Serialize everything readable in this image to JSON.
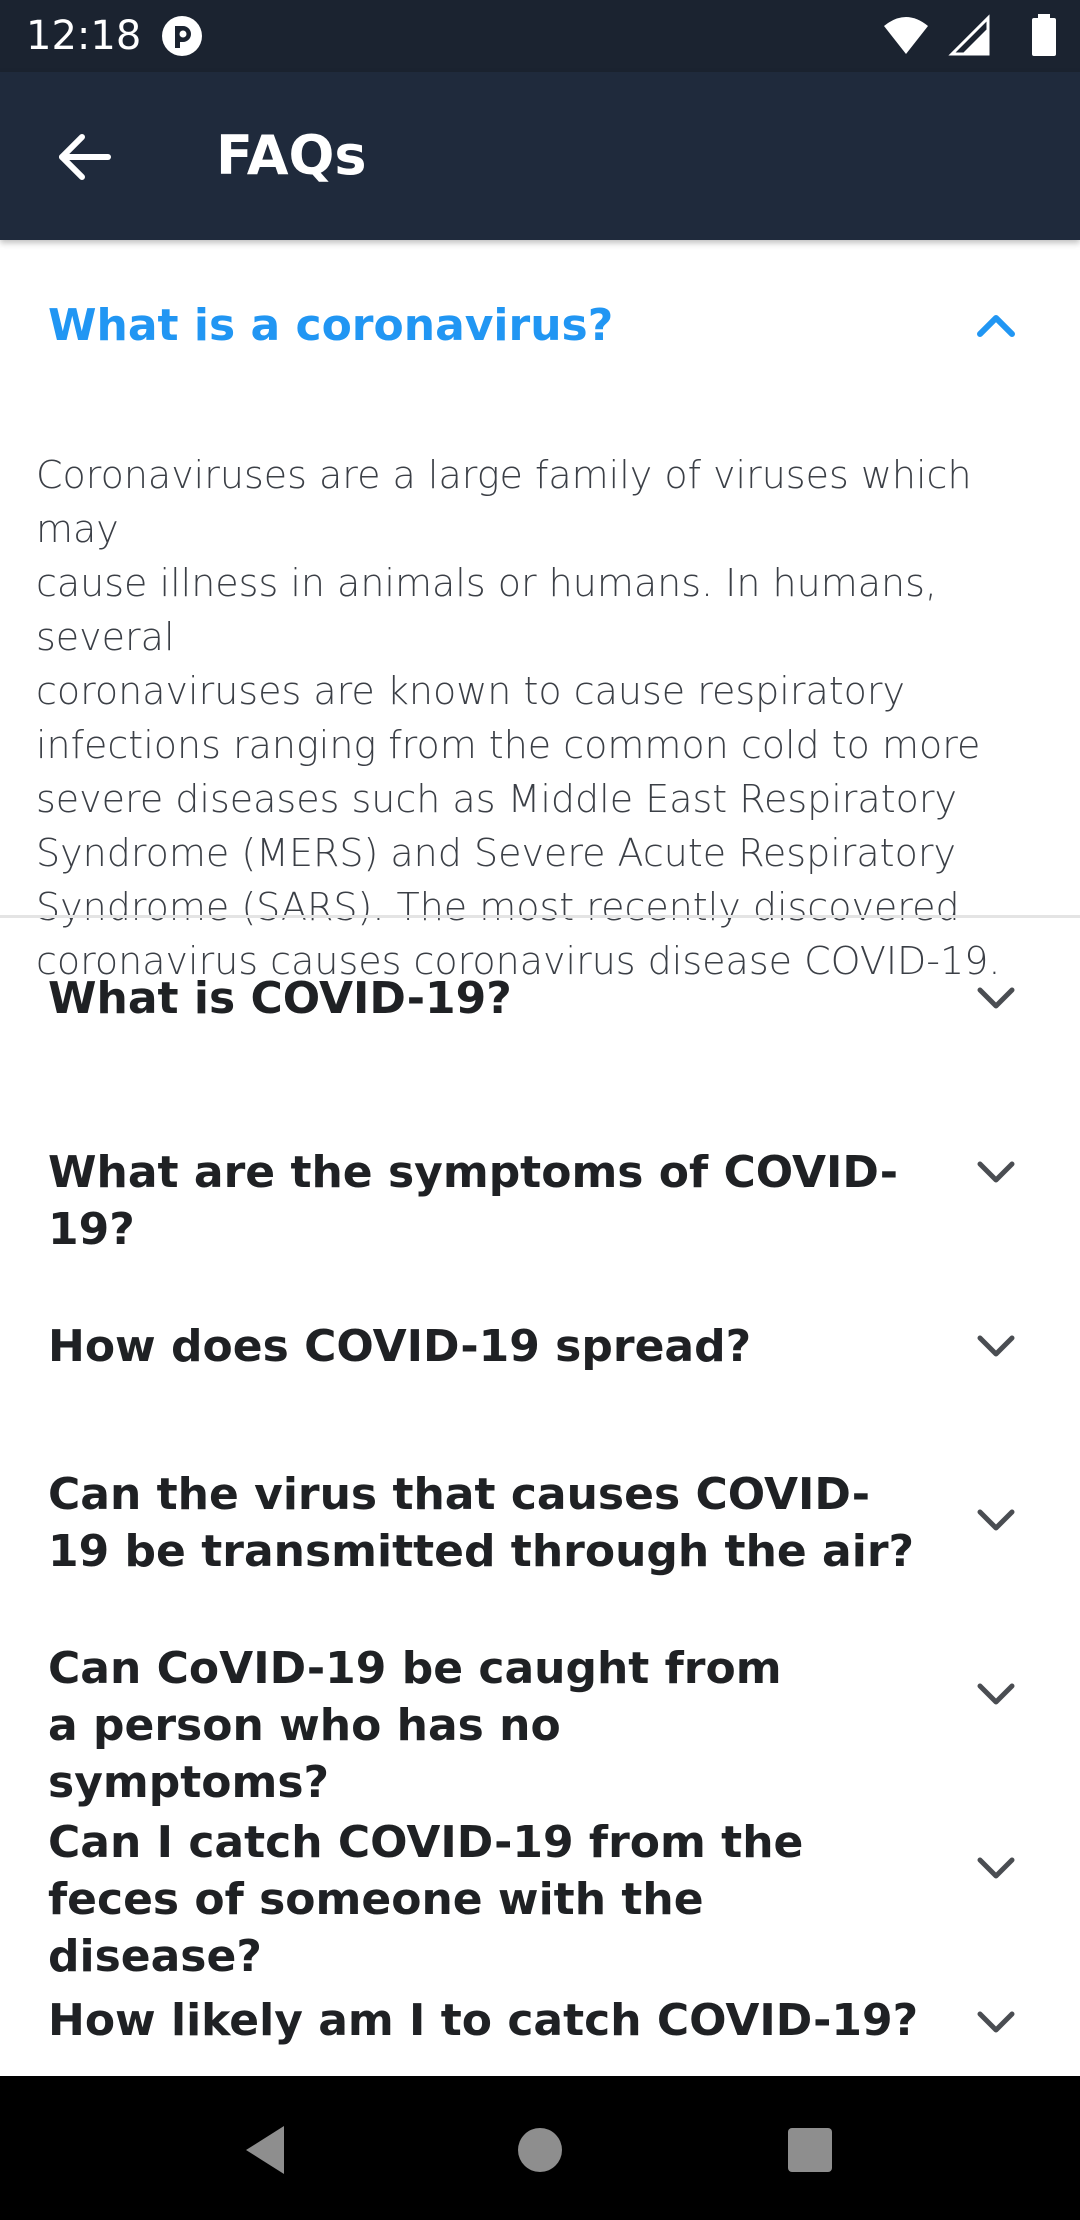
{
  "status_bar": {
    "time": "12:18",
    "icons": [
      "app-notification-icon",
      "wifi-icon",
      "cellular-signal-icon",
      "battery-icon"
    ]
  },
  "app_bar": {
    "title": "FAQs",
    "back_icon": "arrow-left-icon"
  },
  "faq": {
    "expanded": {
      "question": "What is a coronavirus?",
      "answer": "Coronaviruses are a large family of viruses which may\ncause illness in animals or humans.  In humans, several\ncoronaviruses are known to cause respiratory\ninfections ranging from the common cold to more\nsevere diseases such as Middle East Respiratory\nSyndrome (MERS) and Severe Acute Respiratory\nSyndrome (SARS). The most recently discovered\ncoronavirus causes coronavirus disease COVID-19.",
      "icon": "chevron-up-icon"
    },
    "items": [
      {
        "question": "What is COVID-19?"
      },
      {
        "question": "What are the symptoms of COVID-19?"
      },
      {
        "question": "How does COVID-19 spread?"
      },
      {
        "question": "Can the virus that causes COVID-19 be transmitted through the air?"
      },
      {
        "question": "Can CoVID-19 be caught from a person who has no symptoms?"
      },
      {
        "question": "Can I catch COVID-19 from the feces of someone with the disease?"
      },
      {
        "question": "How likely am I to catch COVID-19?"
      }
    ],
    "collapsed_icon": "chevron-down-icon"
  },
  "colors": {
    "accent": "#2196f3",
    "app_bar": "#1f2a3c",
    "status_bar": "#1b2330",
    "question_text": "#1f2124",
    "answer_text": "#3b3f46"
  },
  "nav_bar": {
    "icons": [
      "nav-back-icon",
      "nav-home-icon",
      "nav-recents-icon"
    ]
  }
}
